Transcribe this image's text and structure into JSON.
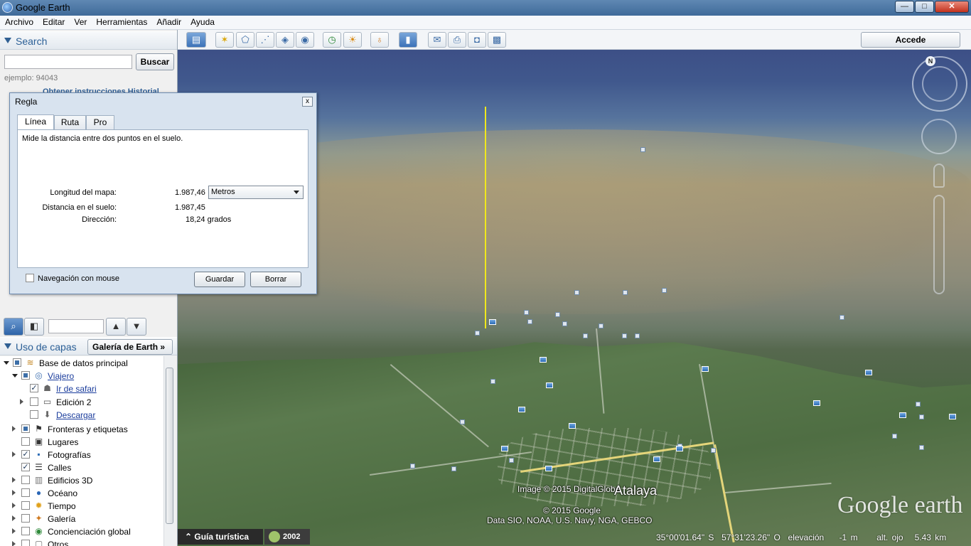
{
  "window": {
    "title": "Google Earth",
    "min": "—",
    "max": "□",
    "close": "✕"
  },
  "menu": [
    "Archivo",
    "Editar",
    "Ver",
    "Herramientas",
    "Añadir",
    "Ayuda"
  ],
  "search": {
    "header": "Search",
    "button": "Buscar",
    "input_value": "",
    "hint": "ejemplo: 94043",
    "links": "Obtener instrucciones   Historial"
  },
  "layers": {
    "header": "Uso de capas",
    "gallery_button": "Galería de Earth »",
    "items": [
      {
        "label": "Base de datos principal",
        "icon": "layers-icon"
      },
      {
        "label": "Viajero",
        "icon": "globe-icon"
      },
      {
        "label": "Ir de safari",
        "icon": "binoculars-icon"
      },
      {
        "label": "Edición 2",
        "icon": "folder-icon"
      },
      {
        "label": "Descargar",
        "icon": "download-icon"
      },
      {
        "label": "Fronteras y etiquetas",
        "icon": "flag-icon"
      },
      {
        "label": "Lugares",
        "icon": "place-icon"
      },
      {
        "label": "Fotografías",
        "icon": "photo-icon"
      },
      {
        "label": "Calles",
        "icon": "roads-icon"
      },
      {
        "label": "Edificios 3D",
        "icon": "buildings-icon"
      },
      {
        "label": "Océano",
        "icon": "ocean-icon"
      },
      {
        "label": "Tiempo",
        "icon": "weather-icon"
      },
      {
        "label": "Galería",
        "icon": "gallery-icon"
      },
      {
        "label": "Concienciación global",
        "icon": "global-icon"
      },
      {
        "label": "Otros",
        "icon": "other-icon"
      }
    ]
  },
  "toolbar": {
    "accede": "Accede"
  },
  "ruler": {
    "title": "Regla",
    "close": "x",
    "tabs": [
      "Línea",
      "Ruta",
      "Pro"
    ],
    "description": "Mide la distancia entre dos puntos en el suelo.",
    "map_length_label": "Longitud del mapa:",
    "map_length_value": "1.987,46",
    "units": "Metros",
    "ground_distance_label": "Distancia en el suelo:",
    "ground_distance_value": "1.987,45",
    "direction_label": "Dirección:",
    "direction_value": "18,24 grados",
    "mouse_nav_label": "Navegación con mouse",
    "save": "Guardar",
    "clear": "Borrar"
  },
  "map": {
    "compass_n": "N",
    "town_label": "Atalaya",
    "imagery_credit": "Image © 2015 DigitalGlobe",
    "google_credit": "© 2015 Google",
    "data_credit": "Data SIO, NOAA, U.S. Navy, NGA, GEBCO",
    "logo": "Google earth",
    "tour_button": "Guía turística",
    "historical_year": "2002",
    "status": {
      "lat": "35°00'01.64\" S",
      "lon": "57°31'23.26\" O",
      "elevation_label": "elevación",
      "elevation": "-1 m",
      "eye_label": "alt. ojo",
      "eye_alt": "5.43 km"
    }
  }
}
